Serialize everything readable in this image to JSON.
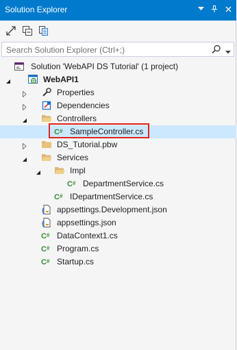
{
  "panel": {
    "title": "Solution Explorer",
    "accent_color": "#007acc",
    "selection_color": "#cce8ff",
    "highlight_color": "#e0241d"
  },
  "search": {
    "placeholder": "Search Solution Explorer (Ctrl+;)",
    "value": ""
  },
  "tree": {
    "solution": "Solution 'WebAPI DS Tutorial' (1 project)",
    "project": "WebAPI1",
    "properties": "Properties",
    "dependencies": "Dependencies",
    "controllers": "Controllers",
    "sample_controller": "SampleController.cs",
    "ds_tutorial": "DS_Tutorial.pbw",
    "services": "Services",
    "impl": "Impl",
    "department_service": "DepartmentService.cs",
    "idepartment_service": "IDepartmentService.cs",
    "appsettings_dev": "appsettings.Development.json",
    "appsettings": "appsettings.json",
    "datacontext": "DataContext1.cs",
    "program": "Program.cs",
    "startup": "Startup.cs"
  }
}
